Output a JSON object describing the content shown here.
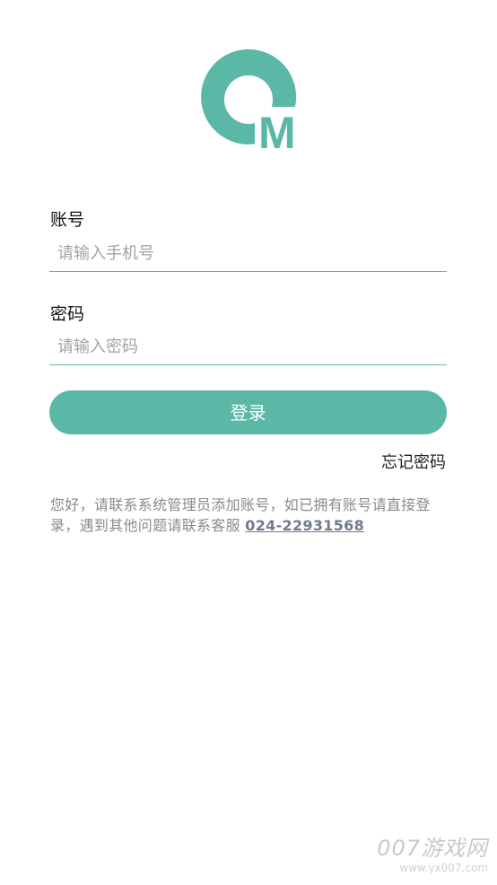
{
  "colors": {
    "accent": "#5bb8a7",
    "text": "#111111",
    "hint": "#a3a3a3",
    "notice": "#8a8a8a",
    "link": "#6f7c8a"
  },
  "logo": {
    "icon": "qm-logo-icon",
    "letter": "M"
  },
  "account": {
    "label": "账号",
    "placeholder": "请输入手机号",
    "value": ""
  },
  "password": {
    "label": "密码",
    "placeholder": "请输入密码",
    "value": ""
  },
  "login_button": "登录",
  "forgot_password": "忘记密码",
  "notice": {
    "text": "您好，请联系系统管理员添加账号，如已拥有账号请直接登录，遇到其他问题请联系客服 ",
    "phone": "024-22931568"
  },
  "watermark": {
    "main": "007游戏网",
    "sub": "www.yx007.com"
  }
}
